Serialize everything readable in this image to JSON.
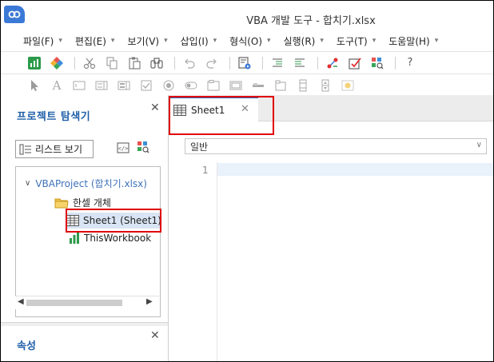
{
  "window": {
    "title": "VBA 개발 도구 - 합치기.xlsx"
  },
  "menu": [
    {
      "label": "파일(F)"
    },
    {
      "label": "편집(E)"
    },
    {
      "label": "보기(V)"
    },
    {
      "label": "삽입(I)"
    },
    {
      "label": "형식(O)"
    },
    {
      "label": "실행(R)"
    },
    {
      "label": "도구(T)"
    },
    {
      "label": "도움말(H)"
    }
  ],
  "toolbar": {
    "help_label": "?"
  },
  "project_explorer": {
    "title": "프로젝트 탐색기",
    "list_view_label": "리스트 보기",
    "tree": {
      "root": "VBAProject (합치기.xlsx)",
      "folder": "한셀 개체",
      "sheet": "Sheet1 (Sheet1)",
      "workbook": "ThisWorkbook"
    }
  },
  "properties": {
    "title": "속성"
  },
  "editor": {
    "tab_label": "Sheet1",
    "combo_value": "일반",
    "line_number": "1"
  },
  "colors": {
    "accent": "#2f6fc2",
    "highlight_box": "#e00000",
    "panel_title": "#1f5fa8"
  }
}
